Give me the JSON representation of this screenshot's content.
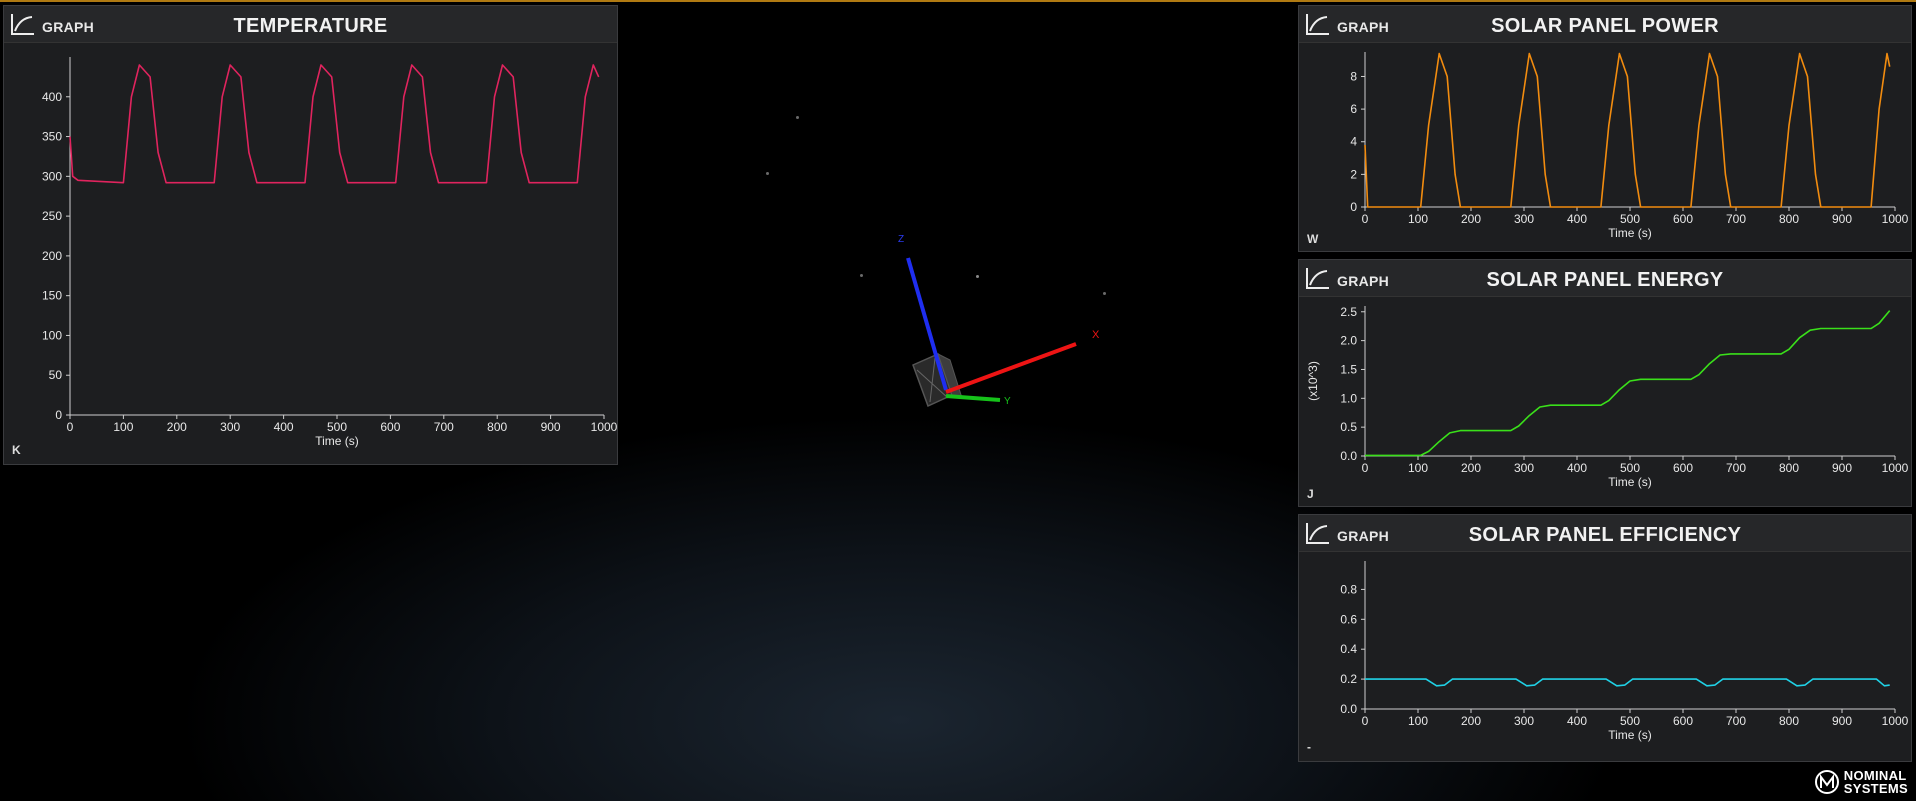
{
  "app": {
    "brand_line1": "NOMINAL",
    "brand_line2": "SYSTEMS"
  },
  "colors": {
    "temperature": "#e0245e",
    "power": "#f28c0f",
    "energy": "#3ae01a",
    "efficiency": "#20d2e6",
    "accent_top": "#b07a12"
  },
  "scene": {
    "axis_x_label": "X",
    "axis_y_label": "Y",
    "axis_z_label": "Z"
  },
  "panels": {
    "temperature": {
      "header": "GRAPH",
      "title": "TEMPERATURE",
      "unit": "K"
    },
    "power": {
      "header": "GRAPH",
      "title": "SOLAR PANEL POWER",
      "unit": "W"
    },
    "energy": {
      "header": "GRAPH",
      "title": "SOLAR PANEL ENERGY",
      "unit": "J"
    },
    "efficiency": {
      "header": "GRAPH",
      "title": "SOLAR PANEL EFFICIENCY",
      "unit": "-"
    }
  },
  "chart_data": [
    {
      "id": "temperature",
      "type": "line",
      "title": "TEMPERATURE",
      "xlabel": "Time (s)",
      "ylabel": "",
      "xlim": [
        0,
        1000
      ],
      "ylim": [
        0,
        450
      ],
      "xticks": [
        0,
        100,
        200,
        300,
        400,
        500,
        600,
        700,
        800,
        900,
        1000
      ],
      "yticks": [
        0,
        50,
        100,
        150,
        200,
        250,
        300,
        350,
        400
      ],
      "series": [
        {
          "color": "#e0245e",
          "x": [
            0,
            5,
            15,
            100,
            115,
            130,
            150,
            165,
            180,
            270,
            285,
            300,
            320,
            335,
            350,
            440,
            455,
            470,
            490,
            505,
            520,
            610,
            625,
            640,
            660,
            675,
            690,
            780,
            795,
            810,
            830,
            845,
            860,
            950,
            965,
            980,
            990
          ],
          "y": [
            350,
            300,
            295,
            292,
            400,
            440,
            425,
            330,
            292,
            292,
            400,
            440,
            425,
            330,
            292,
            292,
            400,
            440,
            425,
            330,
            292,
            292,
            400,
            440,
            425,
            330,
            292,
            292,
            400,
            440,
            425,
            330,
            292,
            292,
            400,
            440,
            425
          ]
        }
      ],
      "grid": false
    },
    {
      "id": "power",
      "type": "line",
      "title": "SOLAR PANEL POWER",
      "xlabel": "Time (s)",
      "ylabel": "",
      "xlim": [
        0,
        1000
      ],
      "ylim": [
        0,
        9.5
      ],
      "xticks": [
        0,
        100,
        200,
        300,
        400,
        500,
        600,
        700,
        800,
        900,
        1000
      ],
      "yticks": [
        0,
        2,
        4,
        6,
        8
      ],
      "series": [
        {
          "color": "#f28c0f",
          "x": [
            0,
            5,
            105,
            120,
            140,
            155,
            170,
            180,
            275,
            290,
            310,
            325,
            340,
            350,
            445,
            460,
            480,
            495,
            510,
            520,
            615,
            630,
            650,
            665,
            680,
            690,
            785,
            800,
            820,
            835,
            850,
            860,
            955,
            970,
            985,
            990
          ],
          "y": [
            3.8,
            0,
            0,
            5,
            9.4,
            8,
            2,
            0,
            0,
            5,
            9.4,
            8,
            2,
            0,
            0,
            5,
            9.4,
            8,
            2,
            0,
            0,
            5,
            9.4,
            8,
            2,
            0,
            0,
            5,
            9.4,
            8,
            2,
            0,
            0,
            6,
            9.4,
            8.6
          ]
        }
      ],
      "grid": false
    },
    {
      "id": "energy",
      "type": "line",
      "title": "SOLAR PANEL ENERGY",
      "xlabel": "Time (s)",
      "ylabel": "(x10^3)",
      "xlim": [
        0,
        1000
      ],
      "ylim": [
        0,
        2.6
      ],
      "xticks": [
        0,
        100,
        200,
        300,
        400,
        500,
        600,
        700,
        800,
        900,
        1000
      ],
      "yticks": [
        0.0,
        0.5,
        1.0,
        1.5,
        2.0,
        2.5
      ],
      "ytick_labels": [
        "0.0",
        "0.5",
        "1.0",
        "1.5",
        "2.0",
        "2.5"
      ],
      "series": [
        {
          "color": "#3ae01a",
          "x": [
            0,
            105,
            120,
            140,
            160,
            180,
            275,
            290,
            310,
            330,
            350,
            445,
            460,
            480,
            500,
            520,
            615,
            630,
            650,
            670,
            690,
            785,
            800,
            820,
            840,
            860,
            955,
            970,
            990
          ],
          "y": [
            0.01,
            0.01,
            0.08,
            0.25,
            0.4,
            0.44,
            0.44,
            0.52,
            0.7,
            0.85,
            0.88,
            0.88,
            0.96,
            1.15,
            1.3,
            1.33,
            1.33,
            1.41,
            1.6,
            1.75,
            1.77,
            1.77,
            1.85,
            2.05,
            2.18,
            2.21,
            2.21,
            2.3,
            2.52
          ]
        }
      ],
      "grid": false
    },
    {
      "id": "efficiency",
      "type": "line",
      "title": "SOLAR PANEL EFFICIENCY",
      "xlabel": "Time (s)",
      "ylabel": "",
      "xlim": [
        0,
        1000
      ],
      "ylim": [
        0,
        0.99
      ],
      "xticks": [
        0,
        100,
        200,
        300,
        400,
        500,
        600,
        700,
        800,
        900,
        1000
      ],
      "yticks": [
        0.0,
        0.2,
        0.4,
        0.6,
        0.8
      ],
      "ytick_labels": [
        "0.0",
        "0.2",
        "0.4",
        "0.6",
        "0.8"
      ],
      "series": [
        {
          "color": "#20d2e6",
          "x": [
            0,
            100,
            115,
            135,
            150,
            165,
            270,
            285,
            305,
            320,
            335,
            440,
            455,
            475,
            490,
            505,
            610,
            625,
            645,
            660,
            675,
            780,
            795,
            815,
            830,
            845,
            950,
            965,
            980,
            990
          ],
          "y": [
            0.2,
            0.2,
            0.2,
            0.155,
            0.16,
            0.2,
            0.2,
            0.2,
            0.155,
            0.16,
            0.2,
            0.2,
            0.2,
            0.155,
            0.16,
            0.2,
            0.2,
            0.2,
            0.155,
            0.16,
            0.2,
            0.2,
            0.2,
            0.155,
            0.16,
            0.2,
            0.2,
            0.2,
            0.155,
            0.16
          ]
        }
      ],
      "grid": false
    }
  ]
}
